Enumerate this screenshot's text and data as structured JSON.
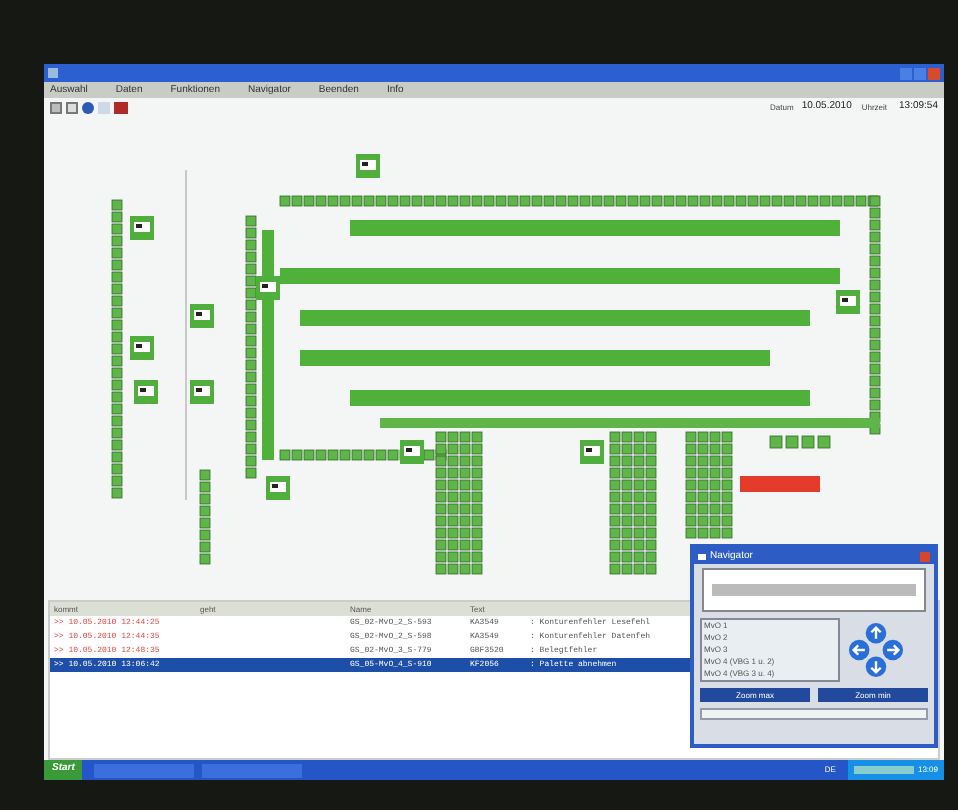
{
  "menu": [
    "Auswahl",
    "Daten",
    "Funktionen",
    "Navigator",
    "Beenden",
    "Info"
  ],
  "clock": {
    "date_label": "Datum",
    "date": "10.05.2010",
    "time_label": "Uhrzeit",
    "time": "13:09:54"
  },
  "alarms": {
    "columns": [
      "kommt",
      "geht",
      "Name",
      "Text"
    ],
    "rows": [
      {
        "kommt": ">> 10.05.2010 12:44:25",
        "name": "GS_02-MvO_2_S-593",
        "code": "KA3549",
        "text": ": Konturenfehler Lesefehl",
        "selected": false
      },
      {
        "kommt": ">> 10.05.2010 12:44:35",
        "name": "GS_02-MvO_2_S-598",
        "code": "KA3549",
        "text": ": Konturenfehler Datenfeh",
        "selected": false
      },
      {
        "kommt": ">> 10.05.2010 12:48:35",
        "name": "GS_02-MvO_3_S-779",
        "code": "GBF3520",
        "text": ": Belegtfehler",
        "selected": false
      },
      {
        "kommt": ">> 10.05.2010 13:06:42",
        "name": "GS_05-MvO_4_S-910",
        "code": "KF2056",
        "text": ": Palette abnehmen",
        "selected": true
      }
    ]
  },
  "navigator": {
    "title": "Navigator",
    "items": [
      {
        "label": "MvO 1",
        "selected": false
      },
      {
        "label": "MvO 2",
        "selected": false
      },
      {
        "label": "MvO 3",
        "selected": false
      },
      {
        "label": "MvO 4 (VBG 1 u. 2)",
        "selected": false
      },
      {
        "label": "MvO 4 (VBG 3 u. 4)",
        "selected": false
      }
    ],
    "buttons": [
      "Zoom max",
      "Zoom min"
    ]
  },
  "taskbar": {
    "start": "Start",
    "language": "DE",
    "time": "13:09"
  }
}
